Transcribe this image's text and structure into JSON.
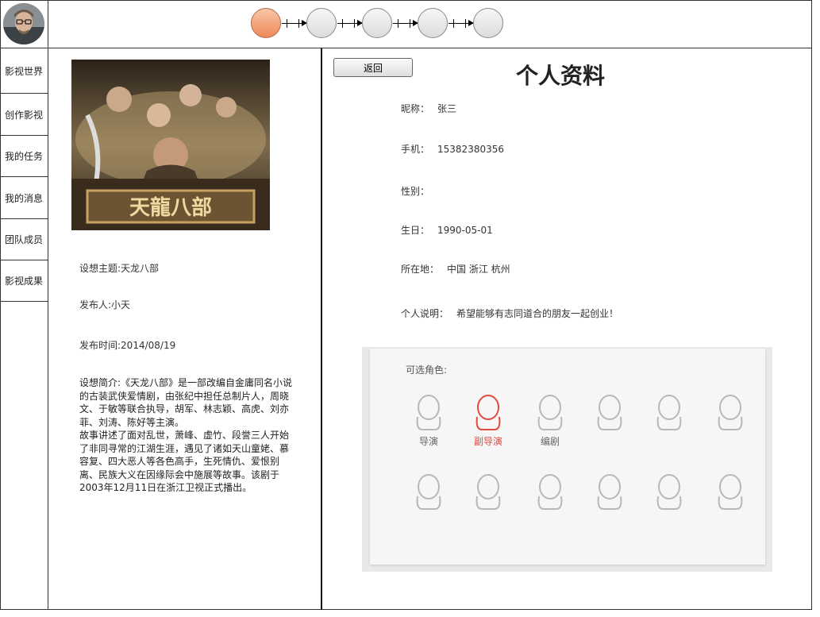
{
  "steps": [
    {
      "name": "step-1",
      "active": true
    },
    {
      "name": "step-2",
      "active": false
    },
    {
      "name": "step-3",
      "active": false
    },
    {
      "name": "step-4",
      "active": false
    },
    {
      "name": "step-5",
      "active": false
    }
  ],
  "sidebar": {
    "items": [
      {
        "label": "影视世界"
      },
      {
        "label": "创作影视"
      },
      {
        "label": "我的任务"
      },
      {
        "label": "我的消息"
      },
      {
        "label": "团队成员"
      },
      {
        "label": "影视成果"
      }
    ]
  },
  "idea": {
    "topic": "设想主题:天龙八部",
    "publisher": "发布人:小天",
    "publish_time": "发布时间:2014/08/19",
    "intro": "设想简介:《天龙八部》是一部改编自金庸同名小说的古装武侠爱情剧，由张纪中担任总制片人，周晓文、于敏等联合执导，胡军、林志颖、高虎、刘亦菲、刘涛、陈好等主演。\n故事讲述了面对乱世，萧峰、虚竹、段誉三人开始了非同寻常的江湖生涯，遇见了诸如天山童姥、慕容复、四大恶人等各色高手，生死情仇、爱恨别离、民族大义在因缘际会中施展等故事。该剧于2003年12月11日在浙江卫视正式播出。"
  },
  "profile": {
    "back_label": "返回",
    "title": "个人资料",
    "fields": [
      {
        "label": "昵称：",
        "value": "张三"
      },
      {
        "label": "手机：",
        "value": "15382380356"
      },
      {
        "label": "性别：",
        "value": ""
      },
      {
        "label": "生日：",
        "value": "1990-05-01"
      },
      {
        "label": "所在地：",
        "value": "中国 浙江 杭州"
      },
      {
        "label": "个人说明：",
        "value": "希望能够有志同道合的朋友一起创业！"
      }
    ]
  },
  "roles": {
    "title": "可选角色:",
    "items": [
      {
        "label": "导演",
        "active": false
      },
      {
        "label": "副导演",
        "active": true
      },
      {
        "label": "编剧",
        "active": false
      },
      {
        "label": "",
        "active": false
      },
      {
        "label": "",
        "active": false
      },
      {
        "label": "",
        "active": false
      },
      {
        "label": "",
        "active": false
      },
      {
        "label": "",
        "active": false
      },
      {
        "label": "",
        "active": false
      },
      {
        "label": "",
        "active": false
      },
      {
        "label": "",
        "active": false
      },
      {
        "label": "",
        "active": false
      }
    ],
    "colors": {
      "inactive": "#b8b8b8",
      "active": "#e04a3f"
    }
  }
}
